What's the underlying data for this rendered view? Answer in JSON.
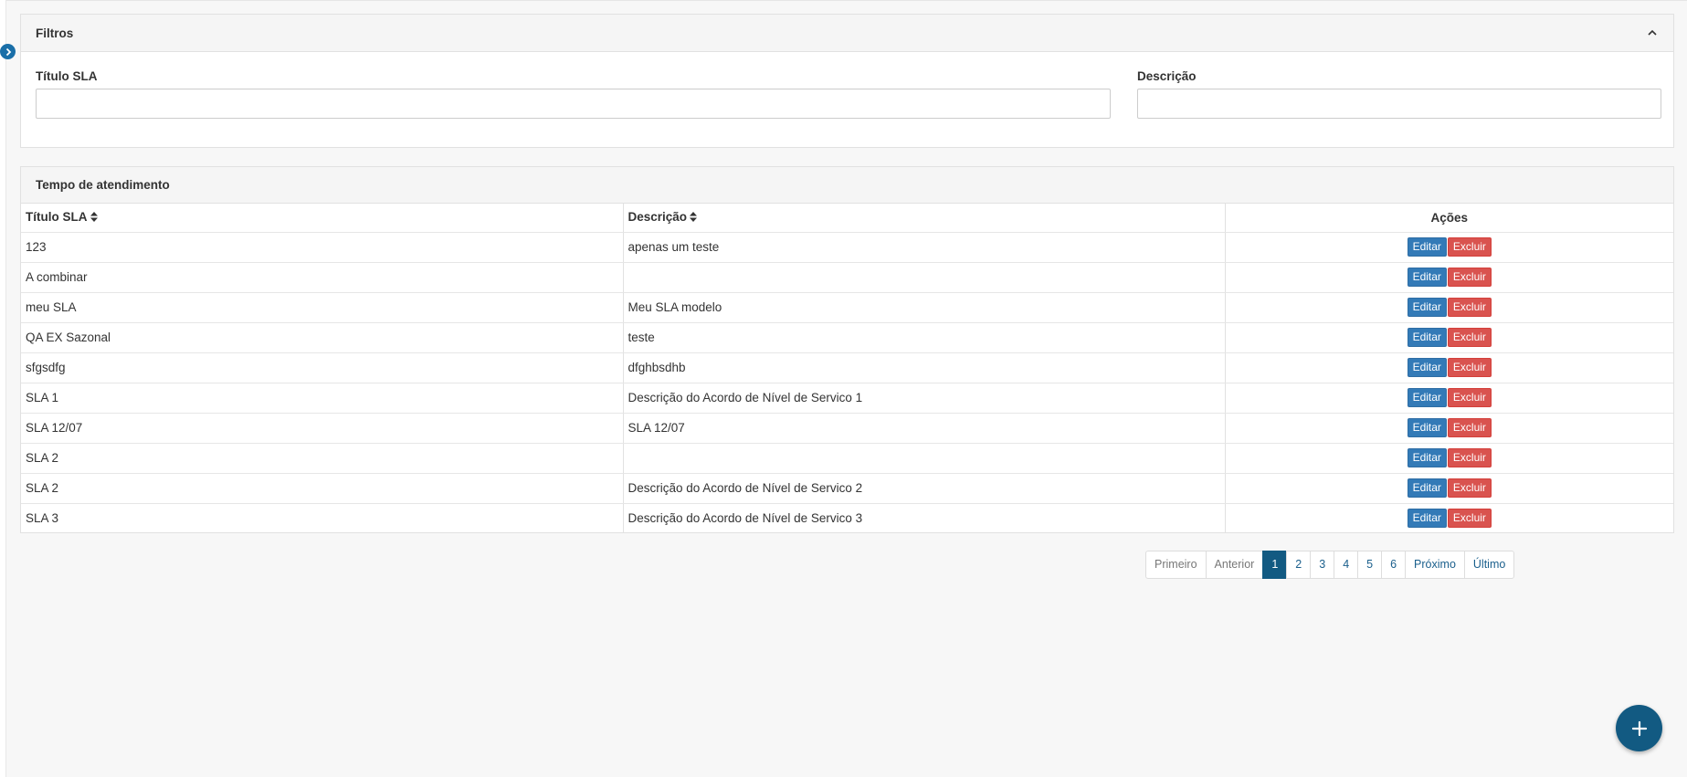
{
  "filters": {
    "heading": "Filtros",
    "title_label": "Título SLA",
    "title_value": "",
    "description_label": "Descrição",
    "description_value": ""
  },
  "results": {
    "heading": "Tempo de atendimento",
    "columns": {
      "title": "Título SLA",
      "description": "Descrição",
      "actions": "Ações"
    },
    "edit_label": "Editar",
    "delete_label": "Excluir",
    "rows": [
      {
        "title": "123",
        "description": "apenas um teste"
      },
      {
        "title": "A combinar",
        "description": ""
      },
      {
        "title": "meu SLA",
        "description": "Meu SLA modelo"
      },
      {
        "title": "QA EX Sazonal",
        "description": "teste"
      },
      {
        "title": "sfgsdfg",
        "description": "dfghbsdhb"
      },
      {
        "title": "SLA 1",
        "description": "Descrição do Acordo de Nível de Servico 1"
      },
      {
        "title": "SLA 12/07",
        "description": "SLA 12/07"
      },
      {
        "title": "SLA 2",
        "description": ""
      },
      {
        "title": "SLA 2",
        "description": "Descrição do Acordo de Nível de Servico 2"
      },
      {
        "title": "SLA 3",
        "description": "Descrição do Acordo de Nível de Servico 3"
      }
    ]
  },
  "pagination": {
    "first": "Primeiro",
    "previous": "Anterior",
    "pages": [
      "1",
      "2",
      "3",
      "4",
      "5",
      "6"
    ],
    "current": "1",
    "next": "Próximo",
    "last": "Último"
  },
  "icons": {
    "sidebar_toggle": "chevron-right-icon",
    "collapse": "chevron-up-icon",
    "sort": "sort-icon",
    "fab": "plus-icon"
  },
  "colors": {
    "primary": "#125a82",
    "edit": "#337ab7",
    "delete": "#d9534f"
  }
}
